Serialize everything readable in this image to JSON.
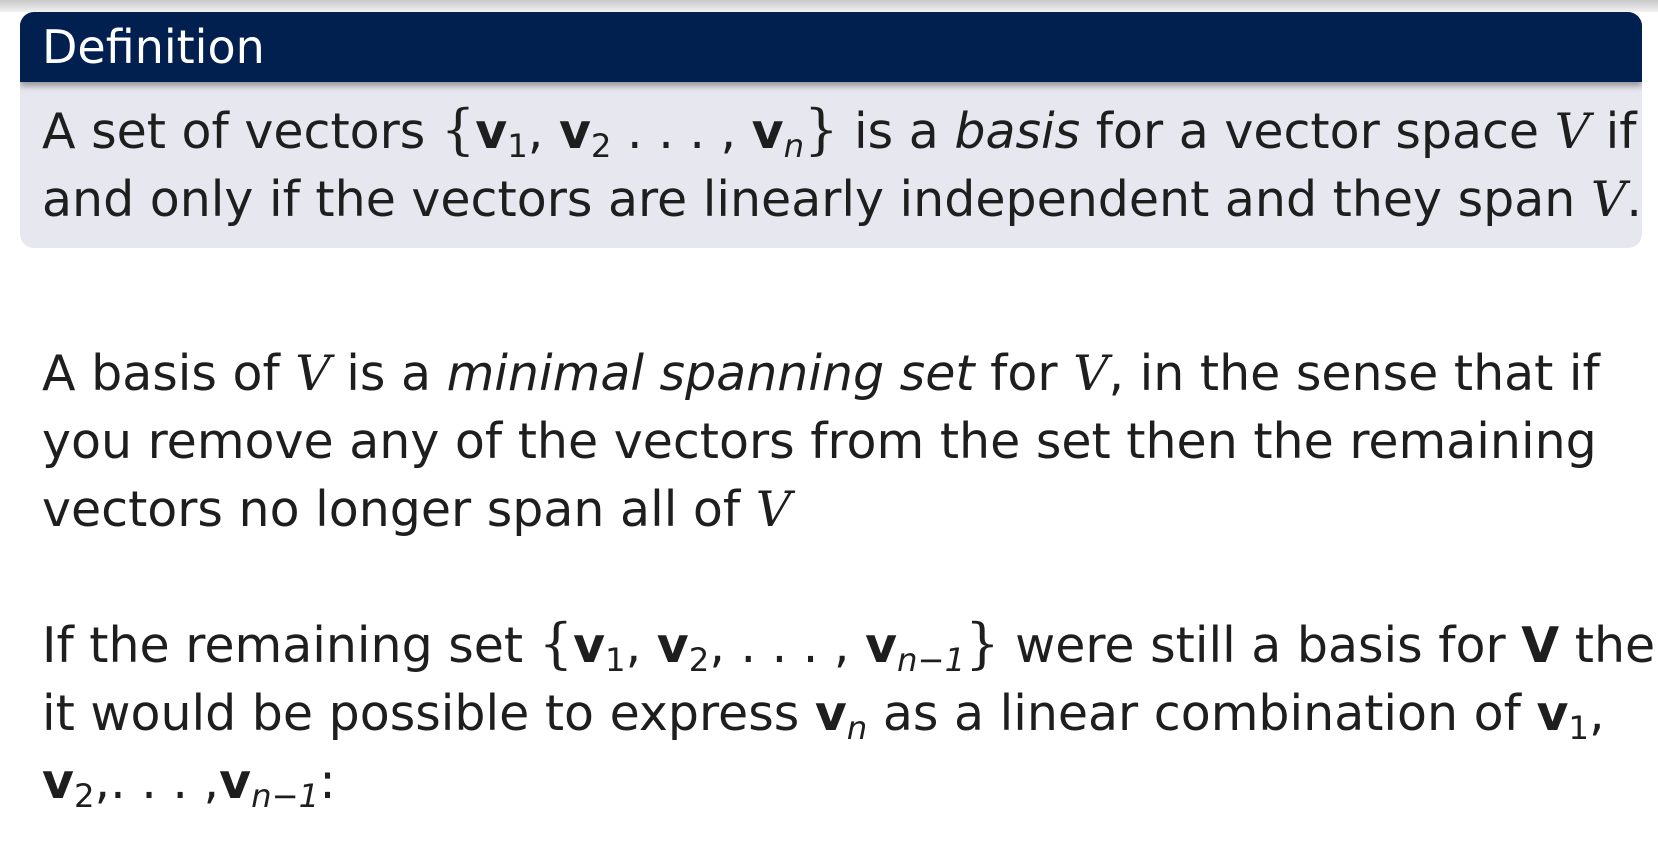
{
  "definition": {
    "heading": "Definition",
    "line1": {
      "t1": "A set of vectors ",
      "ob": "{",
      "v": "v",
      "s1": "1",
      "c1": ", ",
      "s2": "2",
      "c2": " . . . , ",
      "sn": "n",
      "cb": "}",
      "t2": " is a ",
      "em": "basis",
      "t3": " for a vector space ",
      "V": "V",
      "t4": " if"
    },
    "line2": {
      "t1": "and only if the vectors are linearly independent and they span ",
      "V": "V",
      "t2": "."
    }
  },
  "para1": {
    "line1": {
      "t1": "A basis of ",
      "V": "V",
      "t2": " is a ",
      "em": "minimal spanning set",
      "t3": " for ",
      "V2": "V",
      "t4": ", in the sense that if"
    },
    "line2": "you remove any of the vectors from the set then the remaining",
    "line3": {
      "t1": "vectors no longer span all of ",
      "V": "V"
    }
  },
  "para2": {
    "line1": {
      "t1": "If the remaining set ",
      "ob": "{",
      "v": "v",
      "s1": "1",
      "c1": ", ",
      "s2": "2",
      "c2": ", . . . , ",
      "sn1": "n−1",
      "cb": "}",
      "t2": " were still a basis for ",
      "Vb": "V",
      "t3": " then"
    },
    "line2": {
      "t1": "it would be possible to express ",
      "v": "v",
      "sn": "n",
      "t2": " as a linear combination of ",
      "s1": "1",
      "t3": ","
    },
    "line3": {
      "v": "v",
      "s2": "2",
      "c": ",. . . ,",
      "sn1": "n−1",
      "colon": ":"
    }
  }
}
